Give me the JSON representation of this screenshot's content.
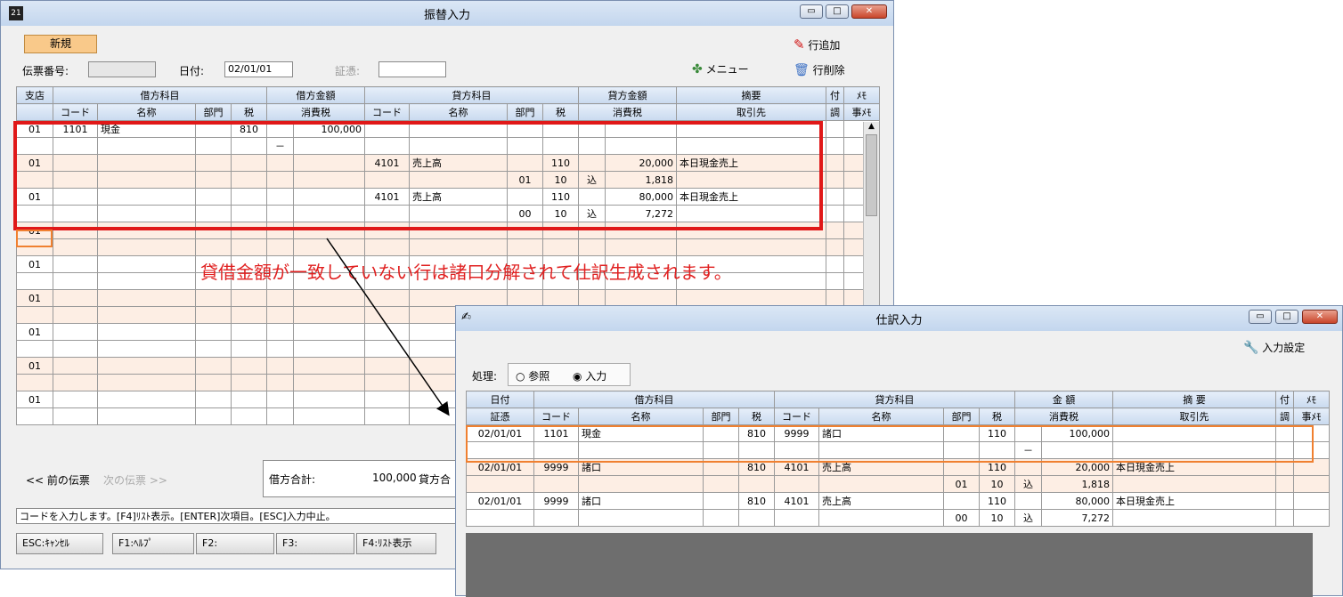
{
  "main_window": {
    "title": "振替入力",
    "new_button": "新規",
    "add_row": "行追加",
    "delete_row": "行削除",
    "menu": "メニュー",
    "voucher_no_label": "伝票番号:",
    "date_label": "日付:",
    "date_value": "02/01/01",
    "evidence_label": "証憑:",
    "header_top": [
      "支店",
      "借方科目",
      "借方金額",
      "貸方科目",
      "貸方金額",
      "摘要",
      "付",
      "ﾒﾓ"
    ],
    "header_bottom": [
      "コード",
      "名称",
      "部門",
      "税",
      "消費税",
      "コード",
      "名称",
      "部門",
      "税",
      "消費税",
      "取引先",
      "調",
      "事ﾒﾓ"
    ],
    "rows": [
      {
        "type": "wt",
        "cells": [
          "01",
          "1101",
          "現金",
          "",
          "810",
          "",
          "100,000",
          "",
          "",
          "",
          "",
          "",
          "",
          "",
          "",
          ""
        ]
      },
      {
        "type": "wt",
        "cells": [
          "",
          "",
          "",
          "",
          "",
          "－",
          "",
          "",
          "",
          "",
          "",
          "",
          "",
          "",
          "",
          ""
        ]
      },
      {
        "type": "pk",
        "cells": [
          "01",
          "",
          "",
          "",
          "",
          "",
          "",
          "4101",
          "売上高",
          "",
          "110",
          "",
          "20,000",
          "本日現金売上",
          "",
          ""
        ]
      },
      {
        "type": "pk",
        "cells": [
          "",
          "",
          "",
          "",
          "",
          "",
          "",
          "",
          "",
          "01",
          "10",
          "込",
          "1,818",
          "",
          "",
          ""
        ]
      },
      {
        "type": "wt",
        "cells": [
          "01",
          "",
          "",
          "",
          "",
          "",
          "",
          "4101",
          "売上高",
          "",
          "110",
          "",
          "80,000",
          "本日現金売上",
          "",
          ""
        ]
      },
      {
        "type": "wt",
        "cells": [
          "",
          "",
          "",
          "",
          "",
          "",
          "",
          "",
          "",
          "00",
          "10",
          "込",
          "7,272",
          "",
          "",
          ""
        ]
      },
      {
        "type": "pk",
        "cells": [
          "01",
          "",
          "",
          "",
          "",
          "",
          "",
          "",
          "",
          "",
          "",
          "",
          "",
          "",
          "",
          ""
        ]
      },
      {
        "type": "pk",
        "cells": [
          "",
          "",
          "",
          "",
          "",
          "",
          "",
          "",
          "",
          "",
          "",
          "",
          "",
          "",
          "",
          ""
        ]
      },
      {
        "type": "wt",
        "cells": [
          "01",
          "",
          "",
          "",
          "",
          "",
          "",
          "",
          "",
          "",
          "",
          "",
          "",
          "",
          "",
          ""
        ]
      },
      {
        "type": "wt",
        "cells": [
          "",
          "",
          "",
          "",
          "",
          "",
          "",
          "",
          "",
          "",
          "",
          "",
          "",
          "",
          "",
          ""
        ]
      },
      {
        "type": "pk",
        "cells": [
          "01",
          "",
          "",
          "",
          "",
          "",
          "",
          "",
          "",
          "",
          "",
          "",
          "",
          "",
          "",
          ""
        ]
      },
      {
        "type": "pk",
        "cells": [
          "",
          "",
          "",
          "",
          "",
          "",
          "",
          "",
          "",
          "",
          "",
          "",
          "",
          "",
          "",
          ""
        ]
      },
      {
        "type": "wt",
        "cells": [
          "01",
          "",
          "",
          "",
          "",
          "",
          "",
          "",
          "",
          "",
          "",
          "",
          "",
          "",
          "",
          ""
        ]
      },
      {
        "type": "wt",
        "cells": [
          "",
          "",
          "",
          "",
          "",
          "",
          "",
          "",
          "",
          "",
          "",
          "",
          "",
          "",
          "",
          ""
        ]
      },
      {
        "type": "pk",
        "cells": [
          "01",
          "",
          "",
          "",
          "",
          "",
          "",
          "",
          "",
          "",
          "",
          "",
          "",
          "",
          "",
          ""
        ]
      },
      {
        "type": "pk",
        "cells": [
          "",
          "",
          "",
          "",
          "",
          "",
          "",
          "",
          "",
          "",
          "",
          "",
          "",
          "",
          "",
          ""
        ]
      },
      {
        "type": "wt",
        "cells": [
          "01",
          "",
          "",
          "",
          "",
          "",
          "",
          "",
          "",
          "",
          "",
          "",
          "",
          "",
          "",
          ""
        ]
      },
      {
        "type": "wt",
        "cells": [
          "",
          "",
          "",
          "",
          "",
          "",
          "",
          "",
          "",
          "",
          "",
          "",
          "",
          "",
          "",
          ""
        ]
      }
    ],
    "prev_voucher": "<< 前の伝票",
    "next_voucher": "次の伝票 >>",
    "debit_total_label": "借方合計:",
    "debit_total_value": "100,000",
    "credit_total_label": "貸方合",
    "status_text": "コードを入力します。[F4]ﾘｽﾄ表示。[ENTER]次項目。[ESC]入力中止。",
    "fkeys": [
      "ESC:ｷｬﾝｾﾙ",
      "F1:ﾍﾙﾌﾟ",
      "F2:",
      "F3:",
      "F4:ﾘｽﾄ表示"
    ]
  },
  "annotation": {
    "text": "貸借金額が一致していない行は諸口分解されて仕訳生成されます。",
    "color": "#e02020"
  },
  "sub_window": {
    "title": "仕訳入力",
    "input_settings": "入力設定",
    "process_label": "処理:",
    "radio_view": "参照",
    "radio_input": "入力",
    "header_top": [
      "日付",
      "借方科目",
      "貸方科目",
      "金 額",
      "摘 要",
      "付",
      "ﾒﾓ"
    ],
    "header_bottom": [
      "証憑",
      "コード",
      "名称",
      "部門",
      "税",
      "コード",
      "名称",
      "部門",
      "税",
      "消費税",
      "取引先",
      "調",
      "事ﾒﾓ"
    ],
    "rows": [
      {
        "type": "wt",
        "cells": [
          "02/01/01",
          "1101",
          "現金",
          "",
          "810",
          "9999",
          "諸口",
          "",
          "110",
          "",
          "100,000",
          "",
          "",
          ""
        ]
      },
      {
        "type": "wt",
        "cells": [
          "",
          "",
          "",
          "",
          "",
          "",
          "",
          "",
          "",
          "－",
          "",
          "",
          "",
          ""
        ]
      },
      {
        "type": "pk",
        "cells": [
          "02/01/01",
          "9999",
          "諸口",
          "",
          "810",
          "4101",
          "売上高",
          "",
          "110",
          "",
          "20,000",
          "本日現金売上",
          "",
          ""
        ]
      },
      {
        "type": "pk",
        "cells": [
          "",
          "",
          "",
          "",
          "",
          "",
          "",
          "01",
          "10",
          "込",
          "1,818",
          "",
          "",
          ""
        ]
      },
      {
        "type": "wt",
        "cells": [
          "02/01/01",
          "9999",
          "諸口",
          "",
          "810",
          "4101",
          "売上高",
          "",
          "110",
          "",
          "80,000",
          "本日現金売上",
          "",
          ""
        ]
      },
      {
        "type": "wt",
        "cells": [
          "",
          "",
          "",
          "",
          "",
          "",
          "",
          "00",
          "10",
          "込",
          "7,272",
          "",
          "",
          ""
        ]
      }
    ]
  },
  "colors": {
    "highlight_red": "#e01818",
    "highlight_orange": "#f08030",
    "row_pink": "#fdeee4",
    "header_blue": "#c9daef"
  }
}
